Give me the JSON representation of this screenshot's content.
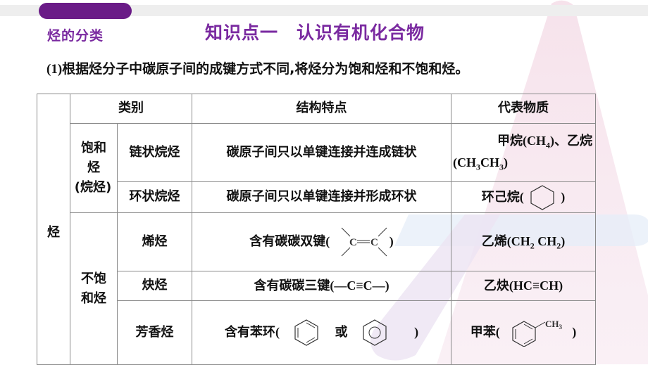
{
  "header": {
    "section_label": "烃的分类",
    "title": "知识点一　认识有机化合物"
  },
  "intro": {
    "number": "(1)",
    "text": "根据烃分子中碳原子间的成键方式不同,将烃分为饱和烃和不饱和烃。"
  },
  "table": {
    "root_label": "烃",
    "headers": {
      "category": "类别",
      "structure": "结构特点",
      "example": "代表物质"
    },
    "groups": {
      "saturated": {
        "label_line1": "饱和",
        "label_line2": "烃",
        "label_line3": "(烷烃)"
      },
      "unsaturated": {
        "label_line1": "不饱",
        "label_line2": "和烃"
      }
    },
    "rows": [
      {
        "type": "链状烷烃",
        "structure": "碳原子间只以单键连接并连成链状",
        "example_cn1": "甲烷",
        "example_f1": "(CH",
        "example_f1_sub": "4",
        "example_f1_end": ")",
        "example_sep": "、",
        "example_cn2": "乙烷",
        "example_f2a": "(CH",
        "example_f2a_sub": "3",
        "example_f2b": "CH",
        "example_f2b_sub": "3",
        "example_f2_end": ")"
      },
      {
        "type": "环状烷烃",
        "structure": "碳原子间只以单键连接并形成环状",
        "example_cn": "环己烷",
        "open": "(",
        "close": ")",
        "example_icon": "cyclohexane-structure-icon"
      },
      {
        "type": "烯烃",
        "structure": "含有碳碳双键",
        "open": "(",
        "close": ")",
        "structure_formula_c": "C",
        "example_cn": "乙烯",
        "example_f_a": "(CH",
        "example_f_sub1": "2",
        "example_f_b": " CH",
        "example_f_sub2": "2",
        "example_f_end": ")"
      },
      {
        "type": "炔烃",
        "structure": "含有碳碳三键",
        "structure_formula": "(—C≡C—)",
        "example_cn": "乙炔",
        "example_formula": "(HC≡CH)"
      },
      {
        "type": "芳香烃",
        "structure": "含有苯环",
        "open": "(",
        "or": "或",
        "close": ")",
        "example_cn": "甲苯",
        "example_ch3": "CH",
        "example_ch3_sub": "3"
      }
    ]
  },
  "colors": {
    "accent_purple": "#7a2aa0",
    "pill_purple": "#6a1b87",
    "border_gray": "#8a8a8a"
  }
}
